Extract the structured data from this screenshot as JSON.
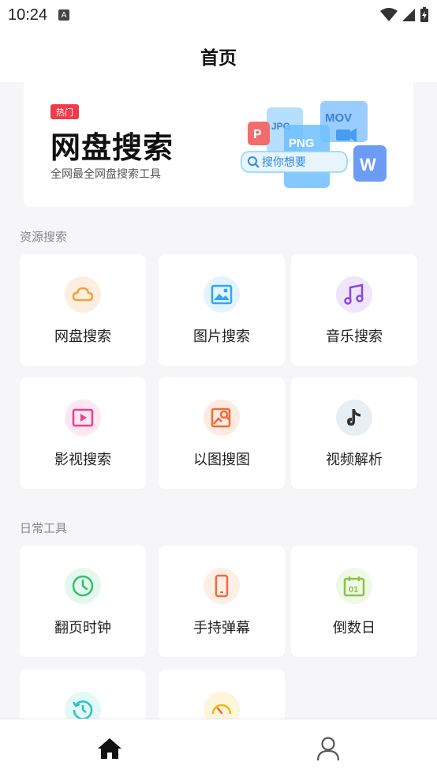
{
  "status_bar": {
    "time": "10:24",
    "notification_letter": "A"
  },
  "header": {
    "title": "首页"
  },
  "banner": {
    "badge": "热门",
    "title": "网盘搜索",
    "subtitle": "全网最全网盘搜索工具",
    "art_labels": {
      "p": "P",
      "jpg": "JPG",
      "png": "PNG",
      "mov": "MOV",
      "w": "W",
      "search": "搜你想要"
    }
  },
  "sections": [
    {
      "title": "资源搜索",
      "items": [
        {
          "label": "网盘搜索",
          "icon": "cloud-icon",
          "color": "#f5a13a"
        },
        {
          "label": "图片搜索",
          "icon": "image-icon",
          "color": "#2fa8f0"
        },
        {
          "label": "音乐搜索",
          "icon": "music-icon",
          "color": "#8a44e0"
        },
        {
          "label": "影视搜索",
          "icon": "video-icon",
          "color": "#ec3f8f"
        },
        {
          "label": "以图搜图",
          "icon": "image-search-icon",
          "color": "#f26a3b"
        },
        {
          "label": "视频解析",
          "icon": "tiktok-icon",
          "color": "#333333"
        }
      ]
    },
    {
      "title": "日常工具",
      "items": [
        {
          "label": "翻页时钟",
          "icon": "clock-icon",
          "color": "#2ec26a"
        },
        {
          "label": "手持弹幕",
          "icon": "phone-icon",
          "color": "#f26a3b"
        },
        {
          "label": "倒数日",
          "icon": "calendar-icon",
          "color": "#8bc34a"
        },
        {
          "label": "",
          "icon": "history-icon",
          "color": "#2dc3c3"
        },
        {
          "label": "",
          "icon": "speedometer-icon",
          "color": "#f2b705"
        }
      ]
    }
  ],
  "tabs": [
    {
      "name": "home",
      "icon": "home-icon",
      "active": true
    },
    {
      "name": "profile",
      "icon": "user-icon",
      "active": false
    }
  ]
}
